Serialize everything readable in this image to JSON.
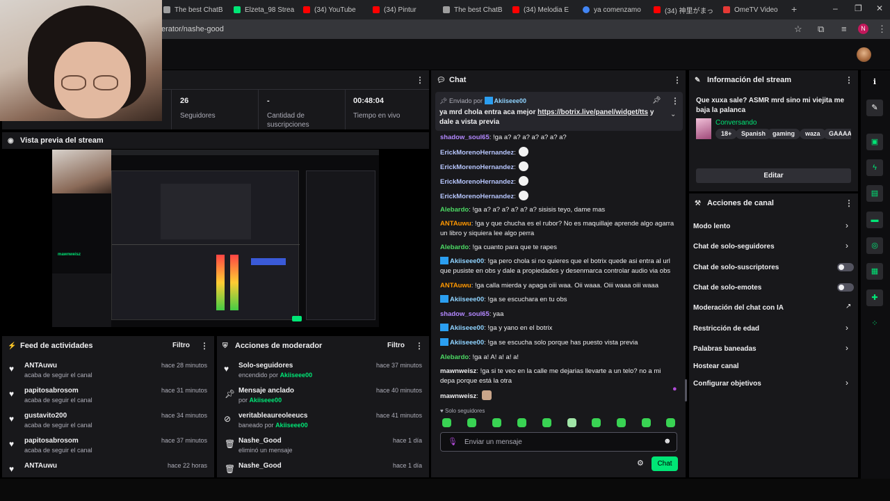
{
  "browser": {
    "tabs": [
      {
        "label": "The best ChatB",
        "color": "#9e9e9e"
      },
      {
        "label": "Elzeta_98 Strea",
        "color": "#00e676"
      },
      {
        "label": "(34) YouTube",
        "color": "#ff0000"
      },
      {
        "label": "(34) Pintur",
        "color": "#ff0000"
      },
      {
        "label": "The best ChatB",
        "color": "#9e9e9e"
      },
      {
        "label": "(34) Melodia E",
        "color": "#ff0000"
      },
      {
        "label": "ya comenzamo",
        "color": "#4285f4"
      },
      {
        "label": "(34) 神里がまっ",
        "color": "#ff0000"
      },
      {
        "label": "OmeTV Video",
        "color": "#e53935"
      }
    ],
    "url": "erator/nashe-good",
    "profile_initial": "N"
  },
  "stats": {
    "followers_value": "26",
    "followers_label": "Seguidores",
    "subs_value": "-",
    "subs_label": "Cantidad de suscripciones",
    "live_value": "00:48:04",
    "live_label": "Tiempo en vivo"
  },
  "preview": {
    "title": "Vista previa del stream",
    "viewer_name": "mawnweisz"
  },
  "activity_feed": {
    "title": "Feed de actividades",
    "filter_label": "Filtro",
    "items": [
      {
        "name": "ANTAuwu",
        "sub": "acaba de seguir el canal",
        "time": "hace 28 minutos"
      },
      {
        "name": "papitosabrosom",
        "sub": "acaba de seguir el canal",
        "time": "hace 31 minutos"
      },
      {
        "name": "gustavito200",
        "sub": "acaba de seguir el canal",
        "time": "hace 34 minutos"
      },
      {
        "name": "papitosabrosom",
        "sub": "acaba de seguir el canal",
        "time": "hace 37 minutos"
      },
      {
        "name": "ANTAuwu",
        "sub": "",
        "time": "hace 22 horas"
      }
    ]
  },
  "mod_actions": {
    "title": "Acciones de moderador",
    "filter_label": "Filtro",
    "items": [
      {
        "name": "Solo-seguidores",
        "sub": "encendido por",
        "by": "Akiiseee00",
        "time": "hace 37 minutos",
        "icon": "heart-icon"
      },
      {
        "name": "Mensaje anclado",
        "sub": "por",
        "by": "Akiiseee00",
        "time": "hace 40 minutos",
        "icon": "pin-icon"
      },
      {
        "name": "veritableaureoleeucs",
        "sub": "baneado por",
        "by": "Akiiseee00",
        "time": "hace 41 minutos",
        "icon": "ban-icon"
      },
      {
        "name": "Nashe_Good",
        "sub": "eliminó un mensaje",
        "by": "",
        "time": "hace 1 día",
        "icon": "trash-icon"
      },
      {
        "name": "Nashe_Good",
        "sub": "",
        "by": "",
        "time": "hace 1 día",
        "icon": "trash-icon"
      }
    ]
  },
  "chat": {
    "title": "Chat",
    "pinned": {
      "sent_by_label": "Enviado por",
      "sender": "Akiiseee00",
      "text_before": "ya mrd chola entra aca mejor ",
      "link": "https://botrix.live/panel/widget/tts",
      "text_after": " y dale a vista previa"
    },
    "messages": [
      {
        "user": "shadow_soul65",
        "color": "#b388ff",
        "badge": false,
        "text": "!ga a? a? a? a? a? a? a?",
        "skull": false
      },
      {
        "user": "ErickMorenoHernandez",
        "color": "#b8c7ff",
        "badge": false,
        "text": "",
        "skull": true
      },
      {
        "user": "ErickMorenoHernandez",
        "color": "#b8c7ff",
        "badge": false,
        "text": "",
        "skull": true
      },
      {
        "user": "ErickMorenoHernandez",
        "color": "#b8c7ff",
        "badge": false,
        "text": "",
        "skull": true
      },
      {
        "user": "ErickMorenoHernandez",
        "color": "#b8c7ff",
        "badge": false,
        "text": "",
        "skull": true
      },
      {
        "user": "Alebardo",
        "color": "#4cd964",
        "badge": false,
        "text": "!ga a? a? a? a? a? a? sisisis teyo, dame mas",
        "skull": false
      },
      {
        "user": "ANTAuwu",
        "color": "#ff9800",
        "badge": false,
        "text": "!ga y que chucha es el rubor? No es maquillaje aprende algo agarra un libro y siquiera lee algo perra",
        "skull": false
      },
      {
        "user": "Alebardo",
        "color": "#4cd964",
        "badge": false,
        "text": "!ga cuanto para que te rapes",
        "skull": false
      },
      {
        "user": "Akiiseee00",
        "color": "#8fd3ff",
        "badge": true,
        "text": "!ga pero chola si no quieres que el botrix quede asi entra al url que pusiste en obs y dale a propiedades y desenmarca controlar audio via obs",
        "skull": false
      },
      {
        "user": "ANTAuwu",
        "color": "#ff9800",
        "badge": false,
        "text": "!ga calla mierda y apaga oiii waa. Oii waaa. Oiii waaa oiii waaa",
        "skull": false
      },
      {
        "user": "Akiiseee00",
        "color": "#8fd3ff",
        "badge": true,
        "text": "!ga se escuchara en tu obs",
        "skull": false
      },
      {
        "user": "shadow_soul65",
        "color": "#b388ff",
        "badge": false,
        "text": "yaa",
        "skull": false
      },
      {
        "user": "Akiiseee00",
        "color": "#8fd3ff",
        "badge": true,
        "text": "!ga y yano en el botrix",
        "skull": false
      },
      {
        "user": "Akiiseee00",
        "color": "#8fd3ff",
        "badge": true,
        "text": "!ga se escucha solo porque has puesto vista previa",
        "skull": false
      },
      {
        "user": "Alebardo",
        "color": "#4cd964",
        "badge": false,
        "text": "!ga a! A! a! a! a!",
        "skull": false
      },
      {
        "user": "mawnweisz",
        "color": "#efeff1",
        "badge": false,
        "text": "!ga si te veo en la calle me dejarias llevarte a un telo? no a mi depa porque está la otra",
        "skull": false
      },
      {
        "user": "mawnweisz",
        "color": "#efeff1",
        "badge": false,
        "text": "",
        "skull": false
      }
    ],
    "followers_only_label": "Solo seguidores",
    "input_placeholder": "Enviar un mensaje",
    "send_label": "Chat"
  },
  "stream_info": {
    "title": "Información del stream",
    "stream_title": "Que xuxa sale? ASMR mrd sino mi viejita me baja la palanca",
    "category": "Conversando",
    "tags": [
      "18+",
      "Spanish",
      "gaming",
      "waza",
      "GAAAAA"
    ],
    "edit_label": "Editar"
  },
  "channel_actions": {
    "title": "Acciones de canal",
    "items": [
      {
        "label": "Modo lento",
        "control": "chevron"
      },
      {
        "label": "Chat de solo-seguidores",
        "control": "chevron"
      },
      {
        "label": "Chat de solo-suscriptores",
        "control": "toggle"
      },
      {
        "label": "Chat de solo-emotes",
        "control": "toggle"
      },
      {
        "label": "Moderación del chat con IA",
        "control": "external"
      },
      {
        "label": "Restricción de edad",
        "control": "chevron"
      },
      {
        "label": "Palabras baneadas",
        "control": "chevron"
      },
      {
        "label": "Hostear canal",
        "control": "none"
      },
      {
        "label": "Configurar objetivos",
        "control": "chevron"
      }
    ]
  },
  "accent_color": "#00e676"
}
